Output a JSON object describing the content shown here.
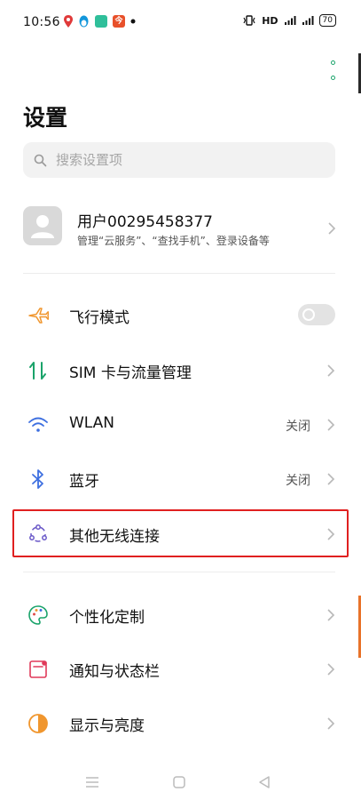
{
  "status_bar": {
    "time": "10:56",
    "network_label": "HD",
    "signal1_label": "4G",
    "signal2_label": "4G",
    "battery": "70"
  },
  "header": {
    "title": "设置"
  },
  "search": {
    "placeholder": "搜索设置项"
  },
  "account": {
    "name": "用户00295458377",
    "subtitle": "管理“云服务”、“查找手机”、登录设备等"
  },
  "settings": {
    "airplane": {
      "label": "飞行模式",
      "state": "off"
    },
    "sim": {
      "label": "SIM 卡与流量管理"
    },
    "wlan": {
      "label": "WLAN",
      "value": "关闭"
    },
    "bluetooth": {
      "label": "蓝牙",
      "value": "关闭"
    },
    "other_wireless": {
      "label": "其他无线连接"
    },
    "personalize": {
      "label": "个性化定制"
    },
    "notification": {
      "label": "通知与状态栏"
    },
    "display": {
      "label": "显示与亮度"
    }
  },
  "colors": {
    "accent_green": "#1aa36a",
    "airplane_orange": "#f0962e",
    "wifi_blue": "#3d6fe0",
    "highlight_red": "#e02020"
  }
}
